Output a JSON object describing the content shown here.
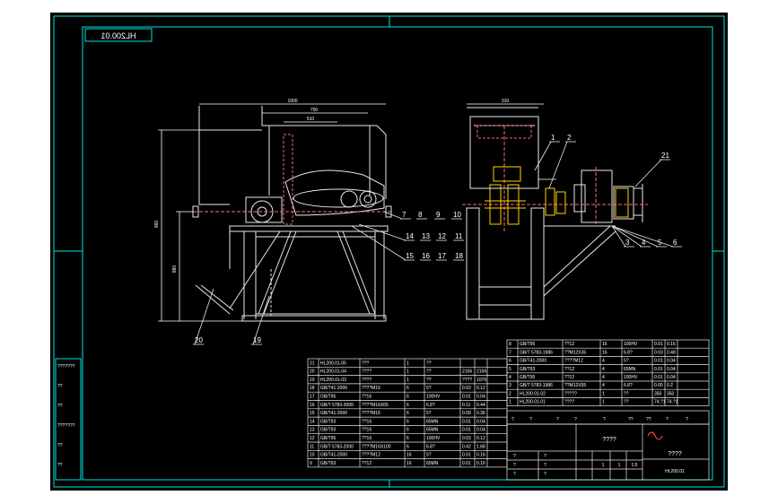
{
  "drawing_number": "HL200.01",
  "colors": {
    "background": "#000000",
    "frame": "#00e5e5",
    "outline": "#e8e8e8",
    "part": "#e8e8e8",
    "dimension": "#ffffff",
    "leader": "#e8e8e8",
    "center_dash": "#ff6a6a",
    "gear": "#ffd400",
    "table_text": "#ffffff"
  },
  "front_view_callouts": [
    "7",
    "8",
    "9",
    "10",
    "14",
    "13",
    "12",
    "11",
    "15",
    "16",
    "17",
    "18",
    "20",
    "19"
  ],
  "side_view_callouts": [
    "1",
    "2",
    "21",
    "3",
    "4",
    "5",
    "6"
  ],
  "dimensions": {
    "top_overall": "1000",
    "top_inner": "750",
    "top_short": "510",
    "side_top": "310",
    "left_height": "960",
    "left_lower": "880",
    "side_height": "600"
  },
  "bom_right": [
    [
      "8",
      "GB/T95",
      "??12",
      "16",
      "100HV",
      "0.01",
      "0.16"
    ],
    [
      "7",
      "GB/T 5783-1986",
      "??M12X35",
      "16",
      "6.8?",
      "0.03",
      "0.48"
    ],
    [
      "6",
      "GB/T41-2000",
      "????M12",
      "4",
      "5?",
      "0.01",
      "0.04"
    ],
    [
      "5",
      "GB/T93",
      "??12",
      "4",
      "65MN",
      "0.01",
      "0.04"
    ],
    [
      "4",
      "GB/T95",
      "??12",
      "4",
      "100HV",
      "0.01",
      "0.04"
    ],
    [
      "3",
      "GB/T 5783-1986",
      "??M12X55",
      "4",
      "6.8?",
      "0.05",
      "0.2"
    ],
    [
      "2",
      "HL200.01-02",
      "?????",
      "1",
      "??",
      "350",
      "350"
    ],
    [
      "1",
      "HL200.01-01",
      "????",
      "1",
      "??",
      "74.?1",
      "74.?1"
    ]
  ],
  "bom_right_header": [
    "?",
    "?",
    "?",
    "?",
    "?",
    "??",
    "??",
    "?",
    "?"
  ],
  "bom_left": [
    [
      "21",
      "HL200.01-05",
      "???",
      "1",
      "??",
      "",
      ""
    ],
    [
      "20",
      "HL200.01-04",
      "????",
      "1",
      "??",
      "2156",
      "2156"
    ],
    [
      "19",
      "HL200.01-03",
      "????",
      "1",
      "??",
      "????",
      "1076"
    ],
    [
      "18",
      "GB/T41-2000",
      "????M16",
      "6",
      "5?",
      "0.03",
      "0.12"
    ],
    [
      "17",
      "GB/T95",
      "??16",
      "6",
      "100HV",
      "0.01",
      "0.04"
    ],
    [
      "16",
      "GB/T 5783-2000",
      "????M16X65",
      "6",
      "6.8?",
      "0.11",
      "0.44"
    ],
    [
      "15",
      "GB/T41-2000",
      "????M16",
      "6",
      "5?",
      "0.09",
      "0.36"
    ],
    [
      "14",
      "GB/T93",
      "??16",
      "6",
      "65MN",
      "0.01",
      "0.04"
    ],
    [
      "13",
      "GB/T93",
      "??16",
      "6",
      "65MN",
      "0.01",
      "0.04"
    ],
    [
      "12",
      "GB/T95",
      "??16",
      "6",
      "100HV",
      "0.03",
      "0.12"
    ],
    [
      "11",
      "GB/T 5783-2000",
      "????M16X100",
      "6",
      "6.8?",
      "0.42",
      "1.68"
    ],
    [
      "10",
      "GB/T41-2000",
      "????M12",
      "16",
      "5?",
      "0.01",
      "0.16"
    ],
    [
      "9",
      "GB/T93",
      "??12",
      "16",
      "65MN",
      "0.01",
      "0.16"
    ]
  ],
  "title_block": {
    "name": "????",
    "drawing_no": "HL200.01",
    "company": "????",
    "scale_sheet": [
      "1",
      "1",
      "1:5"
    ],
    "labels": [
      "?",
      "?",
      "?",
      "?",
      "?",
      "?"
    ]
  },
  "left_strip_labels": [
    "???????",
    "??",
    "??",
    "???????",
    "??",
    "??"
  ]
}
